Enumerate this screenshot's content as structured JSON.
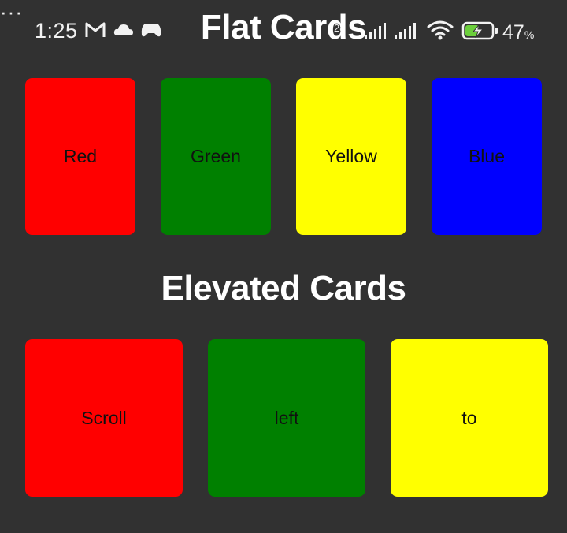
{
  "status_bar": {
    "time": "1:25",
    "notification_icons": [
      "gmail-icon",
      "cloud-icon",
      "game-controller-icon"
    ],
    "overflow_indicator": "···",
    "network_speed": "28",
    "battery_percent": "47",
    "battery_percent_sign": "%"
  },
  "flat_section": {
    "title": "Flat Cards",
    "cards": [
      {
        "label": "Red",
        "color": "#ff0000"
      },
      {
        "label": "Green",
        "color": "#008000"
      },
      {
        "label": "Yellow",
        "color": "#ffff00"
      },
      {
        "label": "Blue",
        "color": "#0000ff"
      }
    ]
  },
  "elevated_section": {
    "title": "Elevated Cards",
    "cards": [
      {
        "label": "Scroll",
        "color": "#ff0000"
      },
      {
        "label": "left",
        "color": "#008000"
      },
      {
        "label": "to",
        "color": "#ffff00"
      }
    ]
  },
  "colors": {
    "background": "#313131",
    "heading_text": "#ffffff",
    "card_text": "#111111"
  }
}
